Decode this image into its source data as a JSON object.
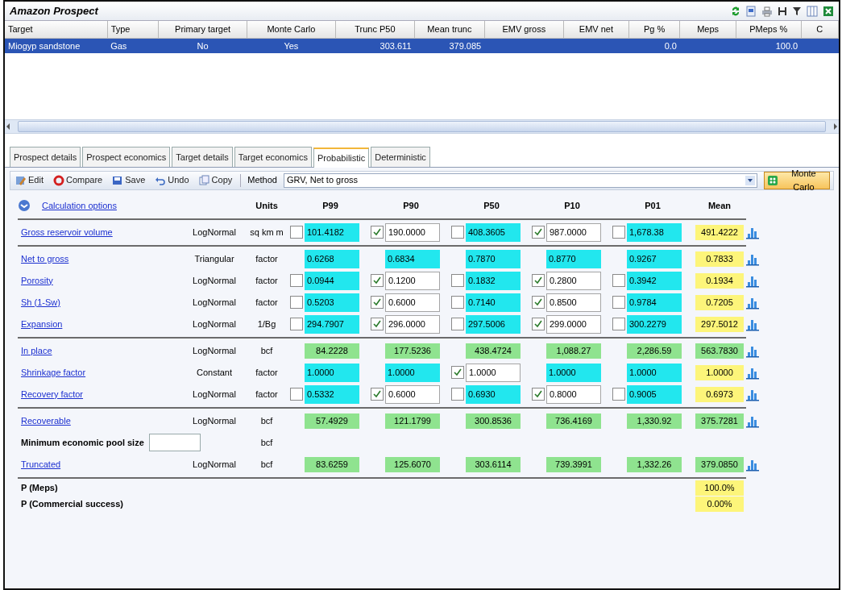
{
  "window": {
    "title": "Amazon Prospect"
  },
  "targets": {
    "columns": [
      "Target",
      "Type",
      "Primary target",
      "Monte Carlo",
      "Trunc P50",
      "Mean trunc",
      "EMV gross",
      "EMV net",
      "Pg %",
      "Meps",
      "PMeps %",
      "C"
    ],
    "rows": [
      {
        "selected": true,
        "cells": [
          "Miogyp sandstone",
          "Gas",
          "No",
          "Yes",
          "303.611",
          "379.085",
          null,
          null,
          "0.0",
          null,
          "100.0",
          null
        ]
      }
    ]
  },
  "tabs": [
    {
      "label": "Prospect details",
      "selected": false
    },
    {
      "label": "Prospect economics",
      "selected": false
    },
    {
      "label": "Target details",
      "selected": false
    },
    {
      "label": "Target economics",
      "selected": false
    },
    {
      "label": "Probabilistic",
      "selected": true
    },
    {
      "label": "Deterministic",
      "selected": false
    }
  ],
  "toolbar": {
    "buttons": [
      {
        "label": "Edit",
        "kind": "edit"
      },
      {
        "label": "Compare",
        "kind": "compare"
      },
      {
        "label": "Save",
        "kind": "save"
      },
      {
        "label": "Undo",
        "kind": "undo"
      },
      {
        "label": "Copy",
        "kind": "copy"
      }
    ],
    "method_label": "Method",
    "method": "GRV, Net to gross",
    "run_button": "Monte Carlo"
  },
  "grid": {
    "options_link": "Calculation options",
    "columns": [
      "Units",
      "P99",
      "P90",
      "P50",
      "P10",
      "P01",
      "Mean"
    ],
    "groups": [
      {
        "rows": [
          {
            "kind": "link",
            "name": "Gross reservoir volume",
            "distribution": "LogNormal",
            "units": "sq km m",
            "cells": [
              {
                "value": "101.4182",
                "kind": "calculated",
                "checked": false
              },
              {
                "value": "190.0000",
                "kind": "input",
                "checked": true
              },
              {
                "value": "408.3605",
                "kind": "calculated",
                "checked": false
              },
              {
                "value": "987.0000",
                "kind": "input",
                "checked": true
              },
              {
                "value": "1,678.38",
                "kind": "calculated",
                "checked": false
              }
            ],
            "mean": {
              "value": "491.4222",
              "kind": "estimate"
            }
          }
        ]
      },
      {
        "rows": [
          {
            "kind": "link",
            "name": "Net to gross",
            "distribution": "Triangular",
            "units": "factor",
            "cells": [
              {
                "value": "0.6268",
                "kind": "calculated"
              },
              {
                "value": "0.6834",
                "kind": "calculated"
              },
              {
                "value": "0.7870",
                "kind": "calculated"
              },
              {
                "value": "0.8770",
                "kind": "calculated"
              },
              {
                "value": "0.9267",
                "kind": "calculated"
              }
            ],
            "mean": {
              "value": "0.7833",
              "kind": "estimate"
            }
          },
          {
            "kind": "link",
            "name": "Porosity",
            "distribution": "LogNormal",
            "units": "factor",
            "cells": [
              {
                "value": "0.0944",
                "kind": "calculated",
                "checked": false
              },
              {
                "value": "0.1200",
                "kind": "input",
                "checked": true
              },
              {
                "value": "0.1832",
                "kind": "calculated",
                "checked": false
              },
              {
                "value": "0.2800",
                "kind": "input",
                "checked": true
              },
              {
                "value": "0.3942",
                "kind": "calculated",
                "checked": false
              }
            ],
            "mean": {
              "value": "0.1934",
              "kind": "estimate"
            }
          },
          {
            "kind": "link",
            "name": "Sh (1-Sw)",
            "distribution": "LogNormal",
            "units": "factor",
            "cells": [
              {
                "value": "0.5203",
                "kind": "calculated",
                "checked": false
              },
              {
                "value": "0.6000",
                "kind": "input",
                "checked": true
              },
              {
                "value": "0.7140",
                "kind": "calculated",
                "checked": false
              },
              {
                "value": "0.8500",
                "kind": "input",
                "checked": true
              },
              {
                "value": "0.9784",
                "kind": "calculated",
                "checked": false
              }
            ],
            "mean": {
              "value": "0.7205",
              "kind": "estimate"
            }
          },
          {
            "kind": "link",
            "name": "Expansion",
            "distribution": "LogNormal",
            "units": "1/Bg",
            "cells": [
              {
                "value": "294.7907",
                "kind": "calculated",
                "checked": false
              },
              {
                "value": "296.0000",
                "kind": "input",
                "checked": true
              },
              {
                "value": "297.5006",
                "kind": "calculated",
                "checked": false
              },
              {
                "value": "299.0000",
                "kind": "input",
                "checked": true
              },
              {
                "value": "300.2279",
                "kind": "calculated",
                "checked": false
              }
            ],
            "mean": {
              "value": "297.5012",
              "kind": "estimate"
            }
          }
        ]
      },
      {
        "rows": [
          {
            "kind": "link",
            "name": "In place",
            "distribution": "LogNormal",
            "units": "bcf",
            "cells": [
              {
                "value": "84.2228",
                "kind": "result"
              },
              {
                "value": "177.5236",
                "kind": "result"
              },
              {
                "value": "438.4724",
                "kind": "result"
              },
              {
                "value": "1,088.27",
                "kind": "result"
              },
              {
                "value": "2,286.59",
                "kind": "result"
              }
            ],
            "mean": {
              "value": "563.7830",
              "kind": "result"
            }
          },
          {
            "kind": "link",
            "name": "Shrinkage factor",
            "distribution": "Constant",
            "units": "factor",
            "cells": [
              {
                "value": "1.0000",
                "kind": "calculated"
              },
              {
                "value": "1.0000",
                "kind": "calculated"
              },
              {
                "value": "1.0000",
                "kind": "input",
                "checked": true
              },
              {
                "value": "1.0000",
                "kind": "calculated"
              },
              {
                "value": "1.0000",
                "kind": "calculated"
              }
            ],
            "mean": {
              "value": "1.0000",
              "kind": "estimate"
            }
          },
          {
            "kind": "link",
            "name": "Recovery factor",
            "distribution": "LogNormal",
            "units": "factor",
            "cells": [
              {
                "value": "0.5332",
                "kind": "calculated",
                "checked": false
              },
              {
                "value": "0.6000",
                "kind": "input",
                "checked": true
              },
              {
                "value": "0.6930",
                "kind": "calculated",
                "checked": false
              },
              {
                "value": "0.8000",
                "kind": "input",
                "checked": true
              },
              {
                "value": "0.9005",
                "kind": "calculated",
                "checked": false
              }
            ],
            "mean": {
              "value": "0.6973",
              "kind": "estimate"
            }
          }
        ]
      },
      {
        "rows": [
          {
            "kind": "link",
            "name": "Recoverable",
            "distribution": "LogNormal",
            "units": "bcf",
            "cells": [
              {
                "value": "57.4929",
                "kind": "result"
              },
              {
                "value": "121.1799",
                "kind": "result"
              },
              {
                "value": "300.8536",
                "kind": "result"
              },
              {
                "value": "736.4169",
                "kind": "result"
              },
              {
                "value": "1,330.92",
                "kind": "result"
              }
            ],
            "mean": {
              "value": "375.7281",
              "kind": "result"
            }
          },
          {
            "kind": "field",
            "name": "Minimum economic pool size",
            "units": "bcf"
          },
          {
            "kind": "link",
            "name": "Truncated",
            "distribution": "LogNormal",
            "units": "bcf",
            "cells": [
              {
                "value": "83.6259",
                "kind": "result"
              },
              {
                "value": "125.6070",
                "kind": "result"
              },
              {
                "value": "303.6114",
                "kind": "result"
              },
              {
                "value": "739.3991",
                "kind": "result"
              },
              {
                "value": "1,332.26",
                "kind": "result"
              }
            ],
            "mean": {
              "value": "379.0850",
              "kind": "result"
            }
          }
        ]
      }
    ],
    "probabilities": [
      {
        "label": "P (Meps)",
        "value": "100.0%"
      },
      {
        "label": "P (Commercial success)",
        "value": "0.00%"
      }
    ]
  }
}
